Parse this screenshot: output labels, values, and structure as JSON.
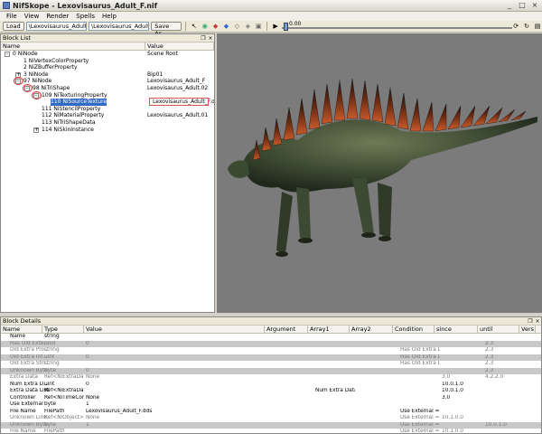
{
  "window": {
    "title": "NifSkope - Lexovisaurus_Adult_F.nif",
    "min": "_",
    "max": "□",
    "close": "×"
  },
  "menu": [
    "File",
    "View",
    "Render",
    "Spells",
    "Help"
  ],
  "toolbar": {
    "load": "Load",
    "load_path": "\\Lexovisaurus_Adult_F.nif",
    "save_path": "\\Lexovisaurus_Adult_F.nif",
    "save_as": "Save As",
    "play_icon": "▶",
    "time_value": "0.00"
  },
  "block_list": {
    "title": "Block List",
    "columns": [
      "Name",
      "Value"
    ],
    "rows": [
      {
        "name": "0   NiNode",
        "value": "Scene Root",
        "indent": 6,
        "expander": "-"
      },
      {
        "name": "1   NiVertexColorProperty",
        "value": "",
        "indent": 18
      },
      {
        "name": "2   NiZBufferProperty",
        "value": "",
        "indent": 18
      },
      {
        "name": "3   NiNode",
        "value": "Bip01",
        "indent": 18,
        "expander": "+"
      },
      {
        "name": "97 NiNode",
        "value": "Lexovisaurus_Adult_F",
        "indent": 18,
        "expander": "-",
        "circle": true
      },
      {
        "name": "98 NiTriShape",
        "value": "Lexovisaurus_Adult.02",
        "indent": 28,
        "expander": "-",
        "circle": true
      },
      {
        "name": "109 NiTexturingProperty",
        "value": "",
        "indent": 38,
        "expander": "-",
        "circle": true
      },
      {
        "name": "110 NiSourceTexture",
        "value": "Lexovisaurus_Adult_F.dds",
        "indent": 48,
        "selected": true,
        "box": true
      },
      {
        "name": "111 NiStencilProperty",
        "value": "",
        "indent": 38
      },
      {
        "name": "112 NiMaterialProperty",
        "value": "Lexovisaurus_Adult.01",
        "indent": 38
      },
      {
        "name": "113 NiTriShapeData",
        "value": "",
        "indent": 38
      },
      {
        "name": "114 NiSkinInstance",
        "value": "",
        "indent": 38,
        "expander": "+"
      }
    ]
  },
  "block_details": {
    "title": "Block Details",
    "columns": [
      "Name",
      "Type",
      "Value",
      "Argument",
      "Array1",
      "Array2",
      "Condition",
      "since",
      "until",
      "Vers"
    ],
    "rows": [
      {
        "c": [
          "Name",
          "string",
          "",
          "",
          "",
          "",
          "",
          "",
          "",
          ""
        ],
        "alt": false,
        "dim": false
      },
      {
        "c": [
          "Has Old Exte...",
          "bool",
          "0",
          "",
          "",
          "",
          "",
          "",
          "2.3",
          ""
        ],
        "alt": true,
        "dim": true
      },
      {
        "c": [
          "Old Extra Pro...",
          "string",
          "",
          "",
          "",
          "",
          "Has Old Extra Data",
          "",
          "2.3",
          ""
        ],
        "alt": false,
        "dim": true
      },
      {
        "c": [
          "Old Extra Int...",
          "uint",
          "0",
          "",
          "",
          "",
          "Has Old Extra Data",
          "",
          "2.3",
          ""
        ],
        "alt": true,
        "dim": true
      },
      {
        "c": [
          "Old Extra Stri...",
          "string",
          "",
          "",
          "",
          "",
          "Has Old Extra Data",
          "",
          "2.3",
          ""
        ],
        "alt": false,
        "dim": true
      },
      {
        "c": [
          "Unknown Byte",
          "byte",
          "0",
          "",
          "",
          "",
          "",
          "",
          "2.3",
          ""
        ],
        "alt": true,
        "dim": true
      },
      {
        "c": [
          "Extra Data",
          "Ref<NiExtraData>",
          "None",
          "",
          "",
          "",
          "",
          "3.0",
          "4.2.2.0",
          ""
        ],
        "alt": false,
        "dim": true
      },
      {
        "c": [
          "Num Extra D...",
          "uint",
          "0",
          "",
          "",
          "",
          "",
          "10.0.1.0",
          "",
          ""
        ],
        "alt": false,
        "dim": false
      },
      {
        "c": [
          "Extra Data List",
          "Ref<NiExtraData>",
          "",
          "",
          "Num Extra Data L...",
          "",
          "",
          "10.0.1.0",
          "",
          ""
        ],
        "alt": false,
        "dim": false
      },
      {
        "c": [
          "Controller",
          "Ref<NiTimeContr...",
          "None",
          "",
          "",
          "",
          "",
          "3.0",
          "",
          ""
        ],
        "alt": false,
        "dim": false
      },
      {
        "c": [
          "Use External",
          "byte",
          "1",
          "",
          "",
          "",
          "",
          "",
          "",
          ""
        ],
        "alt": false,
        "dim": false
      },
      {
        "c": [
          "File Name",
          "FilePath",
          "Lexovisaurus_Adult_F.dds",
          "",
          "",
          "",
          "Use External == 1",
          "",
          "",
          ""
        ],
        "alt": false,
        "dim": false
      },
      {
        "c": [
          "Unknown Link",
          "Ref<NiObject>",
          "None",
          "",
          "",
          "",
          "Use External == 1",
          "10.1.0.0",
          "",
          ""
        ],
        "alt": false,
        "dim": true
      },
      {
        "c": [
          "Unknown Byte",
          "byte",
          "1",
          "",
          "",
          "",
          "Use External == 0",
          "",
          "10.0.1.0",
          ""
        ],
        "alt": true,
        "dim": true
      },
      {
        "c": [
          "File Name",
          "FilePath",
          "",
          "",
          "",
          "",
          "Use External == 0",
          "10.1.0.0",
          "",
          ""
        ],
        "alt": false,
        "dim": true
      }
    ]
  }
}
